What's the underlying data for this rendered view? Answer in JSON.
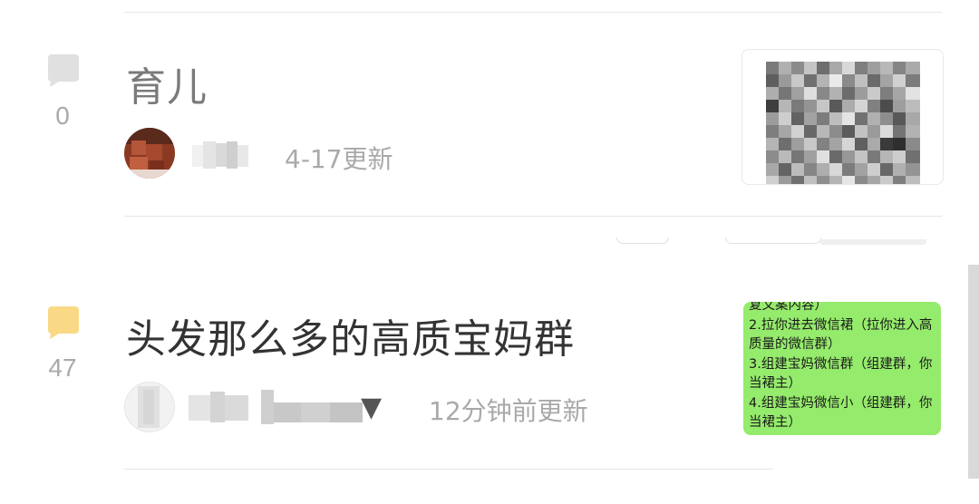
{
  "feed": {
    "items": [
      {
        "title": "育儿",
        "comment_count": "0",
        "updated": "4-17更新",
        "icon": "comment-bubble-icon",
        "icon_color": "#e0e0e0"
      },
      {
        "title": "头发那么多的高质宝妈群",
        "comment_count": "47",
        "updated": "12分钟前更新",
        "icon": "comment-bubble-icon",
        "icon_color": "#fad986",
        "dropdown_icon": "▼",
        "thumb_lines": [
          "复文案内容）",
          "2.拉你进去微信裙（拉你进入高",
          "质量的微信群）",
          "3.组建宝妈微信群（组建群，你",
          "当裙主）",
          "4.组建宝妈微信小（组建群，你",
          "当裙主）"
        ],
        "thumb_color": "#95eb6c"
      }
    ]
  },
  "colors": {
    "title_read": "#7a7a7a",
    "title_unread": "#333333",
    "meta_text": "#a9a9a9",
    "divider": "#e6e6e6"
  }
}
